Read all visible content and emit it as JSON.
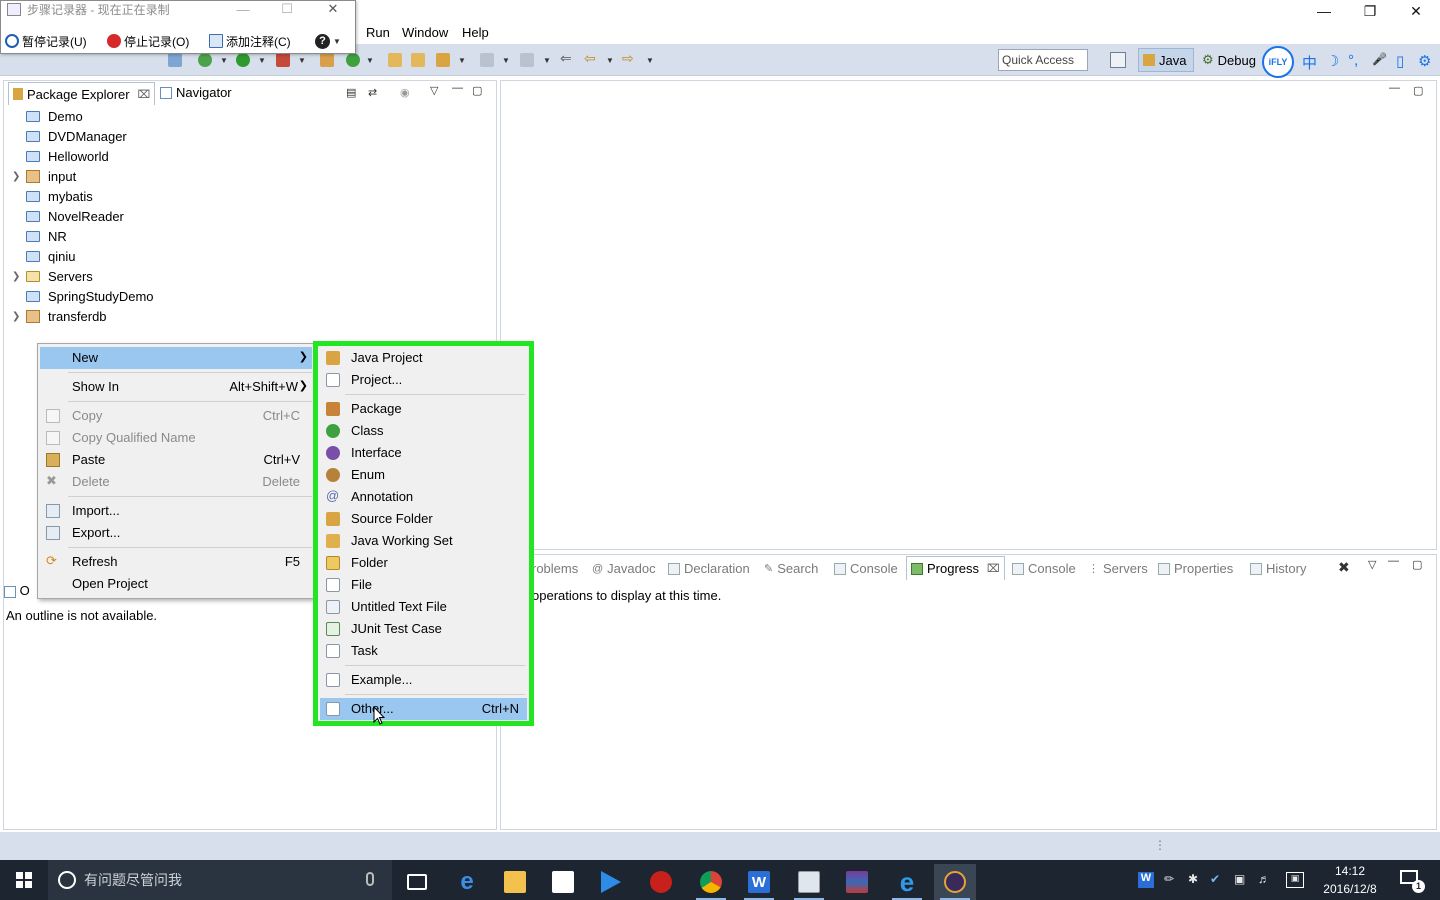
{
  "recorder": {
    "title": "步骤记录器 - 现在正在录制",
    "pause_label": "暂停记录(U)",
    "stop_label": "停止记录(O)",
    "comment_label": "添加注释(C)"
  },
  "menubar": {
    "items": [
      "Run",
      "Window",
      "Help"
    ]
  },
  "toolbar": {
    "quick_access_placeholder": "Quick Access",
    "perspectives": [
      "Java",
      "Debug"
    ],
    "ifly_label": "iFLY",
    "ifly_buttons": [
      "中",
      "☽",
      "°,",
      "🎤",
      "▯",
      "⚙"
    ]
  },
  "package_explorer": {
    "tabs": [
      "Package Explorer",
      "Navigator"
    ],
    "items": [
      {
        "label": "Demo",
        "expandable": false,
        "kind": "folder"
      },
      {
        "label": "DVDManager",
        "expandable": false,
        "kind": "folder"
      },
      {
        "label": "Helloworld",
        "expandable": false,
        "kind": "folder"
      },
      {
        "label": "input",
        "expandable": true,
        "kind": "project"
      },
      {
        "label": "mybatis",
        "expandable": false,
        "kind": "folder"
      },
      {
        "label": "NovelReader",
        "expandable": false,
        "kind": "folder"
      },
      {
        "label": "NR",
        "expandable": false,
        "kind": "folder"
      },
      {
        "label": "qiniu",
        "expandable": false,
        "kind": "folder"
      },
      {
        "label": "Servers",
        "expandable": true,
        "kind": "folder"
      },
      {
        "label": "SpringStudyDemo",
        "expandable": false,
        "kind": "folder"
      },
      {
        "label": "transferdb",
        "expandable": true,
        "kind": "project"
      }
    ]
  },
  "outline": {
    "tab_label": "O",
    "message": "An outline is not available."
  },
  "bottom_panel": {
    "tabs": [
      "roblems",
      "Javadoc",
      "Declaration",
      "Search",
      "Console",
      "Progress",
      "Console",
      "Servers",
      "Properties",
      "History"
    ],
    "active_tab": "Progress",
    "message": "operations to display at this time."
  },
  "context_menu": {
    "items": [
      {
        "label": "New",
        "shortcut": "",
        "disabled": false,
        "submenu": true,
        "highlighted": true
      },
      {
        "label": "Show In",
        "shortcut": "Alt+Shift+W",
        "disabled": false,
        "submenu": true
      },
      {
        "label": "Copy",
        "shortcut": "Ctrl+C",
        "disabled": true
      },
      {
        "label": "Copy Qualified Name",
        "shortcut": "",
        "disabled": true
      },
      {
        "label": "Paste",
        "shortcut": "Ctrl+V",
        "disabled": false
      },
      {
        "label": "Delete",
        "shortcut": "Delete",
        "disabled": true
      },
      {
        "label": "Import...",
        "shortcut": "",
        "disabled": false
      },
      {
        "label": "Export...",
        "shortcut": "",
        "disabled": false
      },
      {
        "label": "Refresh",
        "shortcut": "F5",
        "disabled": false
      },
      {
        "label": "Open Project",
        "shortcut": "",
        "disabled": false
      }
    ]
  },
  "new_submenu": {
    "items": [
      {
        "label": "Java Project",
        "shortcut": ""
      },
      {
        "label": "Project...",
        "shortcut": ""
      },
      {
        "label": "Package",
        "shortcut": ""
      },
      {
        "label": "Class",
        "shortcut": ""
      },
      {
        "label": "Interface",
        "shortcut": ""
      },
      {
        "label": "Enum",
        "shortcut": ""
      },
      {
        "label": "Annotation",
        "shortcut": ""
      },
      {
        "label": "Source Folder",
        "shortcut": ""
      },
      {
        "label": "Java Working Set",
        "shortcut": ""
      },
      {
        "label": "Folder",
        "shortcut": ""
      },
      {
        "label": "File",
        "shortcut": ""
      },
      {
        "label": "Untitled Text File",
        "shortcut": ""
      },
      {
        "label": "JUnit Test Case",
        "shortcut": ""
      },
      {
        "label": "Task",
        "shortcut": ""
      },
      {
        "label": "Example...",
        "shortcut": ""
      },
      {
        "label": "Other...",
        "shortcut": "Ctrl+N",
        "highlighted": true
      }
    ]
  },
  "taskbar": {
    "search_placeholder": "有问题尽管问我",
    "clock_time": "14:12",
    "clock_date": "2016/12/8",
    "notification_count": "1"
  },
  "colors": {
    "highlight": "#99c7f0",
    "annotation_green": "#22e622",
    "toolbar_bg": "#d6dfeb",
    "taskbar_bg": "#1c2530"
  }
}
